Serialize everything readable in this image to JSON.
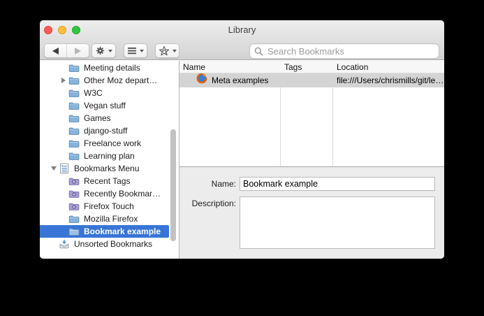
{
  "window": {
    "title": "Library"
  },
  "toolbar": {
    "back_icon": "back-arrow",
    "forward_icon": "forward-arrow",
    "action_icon": "gear",
    "views_icon": "list-lines",
    "import_icon": "star-sync",
    "search": {
      "placeholder": "Search Bookmarks",
      "icon": "magnifier"
    }
  },
  "sidebar": {
    "items": [
      {
        "label": "Meeting details",
        "icon": "folder-icon",
        "level": 2
      },
      {
        "label": "Other Moz depart…",
        "icon": "folder-icon",
        "level": 2,
        "arrow": "right"
      },
      {
        "label": "W3C",
        "icon": "folder-icon",
        "level": 2
      },
      {
        "label": "Vegan stuff",
        "icon": "folder-icon",
        "level": 2
      },
      {
        "label": "Games",
        "icon": "folder-icon",
        "level": 2
      },
      {
        "label": "django-stuff",
        "icon": "folder-icon",
        "level": 2
      },
      {
        "label": "Freelance work",
        "icon": "folder-icon",
        "level": 2
      },
      {
        "label": "Learning plan",
        "icon": "folder-icon",
        "level": 2
      },
      {
        "label": "Bookmarks Menu",
        "icon": "bookmarks-menu-icon",
        "level": 1,
        "arrow": "down"
      },
      {
        "label": "Recent Tags",
        "icon": "smart-folder-icon",
        "level": 2
      },
      {
        "label": "Recently Bookmar…",
        "icon": "smart-folder-icon",
        "level": 2
      },
      {
        "label": "Firefox Touch",
        "icon": "smart-folder-icon",
        "level": 2
      },
      {
        "label": "Mozilla Firefox",
        "icon": "folder-icon",
        "level": 2
      },
      {
        "label": "Bookmark example",
        "icon": "folder-icon",
        "level": 2,
        "selected": true
      },
      {
        "label": "Unsorted Bookmarks",
        "icon": "unsorted-bookmarks-icon",
        "level": 1
      }
    ]
  },
  "table": {
    "columns": [
      "Name",
      "Tags",
      "Location"
    ],
    "rows": [
      {
        "icon": "firefox-icon",
        "name": "Meta examples",
        "tags": "",
        "location": "file:///Users/chrismills/git/le…",
        "selected": true
      }
    ]
  },
  "details": {
    "name_label": "Name:",
    "name_value": "Bookmark example",
    "description_label": "Description:",
    "description_value": ""
  },
  "colors": {
    "selection_blue": "#3875d7",
    "inactive_selection": "#d4d4d4",
    "folder_blue": "#85b3dc",
    "smart_folder_purple": "#a79ed2"
  }
}
